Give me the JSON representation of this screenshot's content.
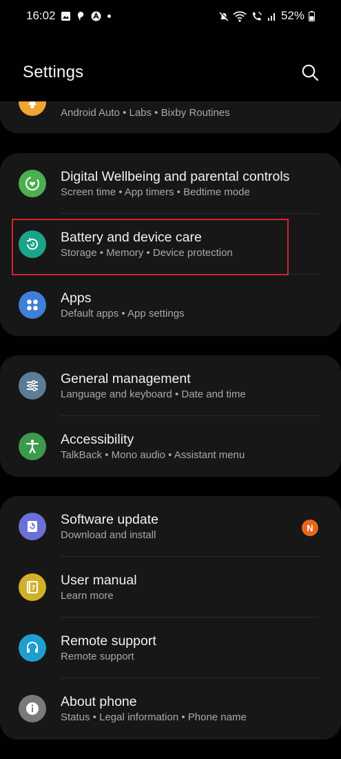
{
  "status_bar": {
    "time": "16:02",
    "battery": "52%",
    "left_icons": [
      "gallery-icon",
      "notification-icon",
      "autoswitch-icon"
    ],
    "right_icons": [
      "mute-icon",
      "wifi-icon",
      "wifi-call-icon",
      "signal-icon",
      "battery-icon"
    ]
  },
  "header": {
    "title": "Settings"
  },
  "partial_row": {
    "subtitle": "Android Auto  •  Labs  •  Bixby Routines",
    "icon": "advanced-features-icon",
    "icon_color": "#f0a431"
  },
  "groups": [
    {
      "items": [
        {
          "title": "Digital Wellbeing and parental controls",
          "subtitle": "Screen time  •  App timers  •  Bedtime mode",
          "icon": "wellbeing-icon",
          "color": "#4caf50"
        },
        {
          "title": "Battery and device care",
          "subtitle": "Storage  •  Memory  •  Device protection",
          "icon": "device-care-icon",
          "color": "#1aa489"
        },
        {
          "title": "Apps",
          "subtitle": "Default apps  •  App settings",
          "icon": "apps-icon",
          "color": "#3f7fd8"
        }
      ]
    },
    {
      "items": [
        {
          "title": "General management",
          "subtitle": "Language and keyboard  •  Date and time",
          "icon": "general-management-icon",
          "color": "#5e7c96"
        },
        {
          "title": "Accessibility",
          "subtitle": "TalkBack  •  Mono audio  •  Assistant menu",
          "icon": "accessibility-icon",
          "color": "#3c9a4c"
        }
      ]
    },
    {
      "items": [
        {
          "title": "Software update",
          "subtitle": "Download and install",
          "icon": "software-update-icon",
          "color": "#6b70d9",
          "badge": "N"
        },
        {
          "title": "User manual",
          "subtitle": "Learn more",
          "icon": "user-manual-icon",
          "color": "#cfb12a"
        },
        {
          "title": "Remote support",
          "subtitle": "Remote support",
          "icon": "remote-support-icon",
          "color": "#1e9fcf"
        },
        {
          "title": "About phone",
          "subtitle": "Status  •  Legal information  •  Phone name",
          "icon": "about-phone-icon",
          "color": "#7a7a7a"
        }
      ]
    }
  ],
  "highlight_color": "#d3262e",
  "badge_color": "#e8671a"
}
